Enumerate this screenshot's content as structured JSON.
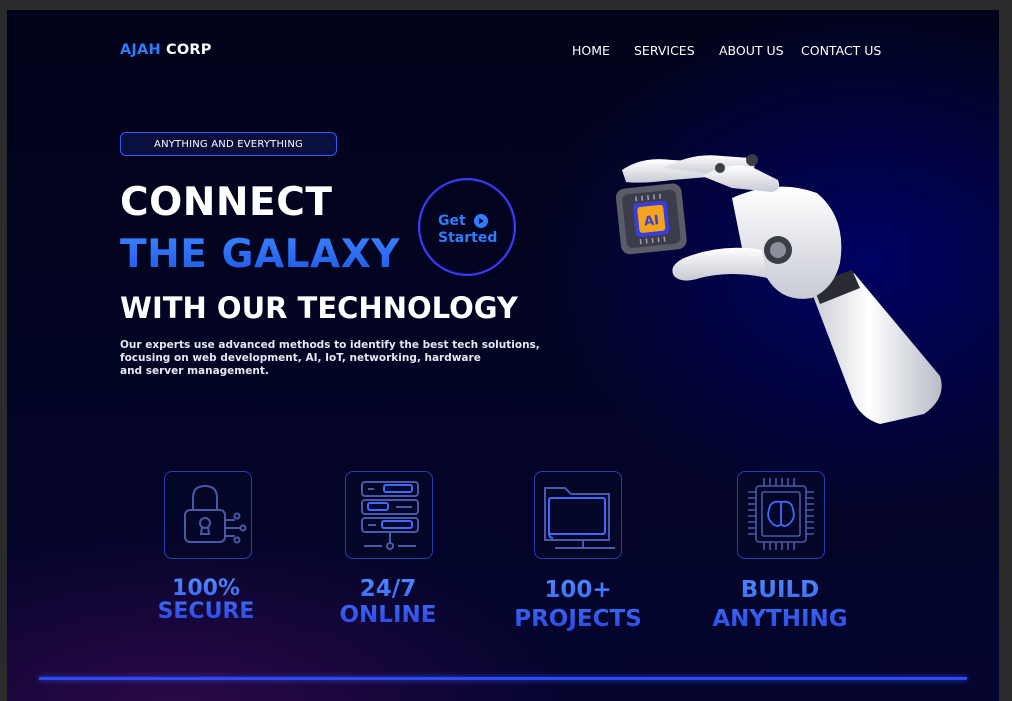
{
  "brand": {
    "part1": "AJAH",
    "part2": "CORP"
  },
  "nav": {
    "home": "HOME",
    "services": "SERVICES",
    "about": "ABOUT US",
    "contact": "CONTACT US"
  },
  "hero": {
    "badge": "ANYTHING AND EVERYTHING",
    "line1": "CONNECT",
    "line2": "THE GALAXY",
    "line3": "WITH OUR TECHNOLOGY",
    "description_lines": [
      "Our experts use advanced methods to identify the best tech solutions,",
      "focusing on web development, AI, IoT, networking, hardware",
      "and server management."
    ],
    "cta_line1": "Get",
    "cta_line2": "Started"
  },
  "robot": {
    "chip_label": "AI"
  },
  "features": [
    {
      "icon": "padlock-circuit-icon",
      "line1": "100%",
      "line2": "SECURE"
    },
    {
      "icon": "server-rack-icon",
      "line1": "24/7",
      "line2": "ONLINE"
    },
    {
      "icon": "folder-monitor-icon",
      "line1": "100+",
      "line2": "PROJECTS"
    },
    {
      "icon": "brain-chip-icon",
      "line1": "BUILD",
      "line2": "ANYTHING"
    }
  ],
  "colors": {
    "accent": "#2f7cff",
    "background": "#020422",
    "border": "#2b3fb0"
  }
}
